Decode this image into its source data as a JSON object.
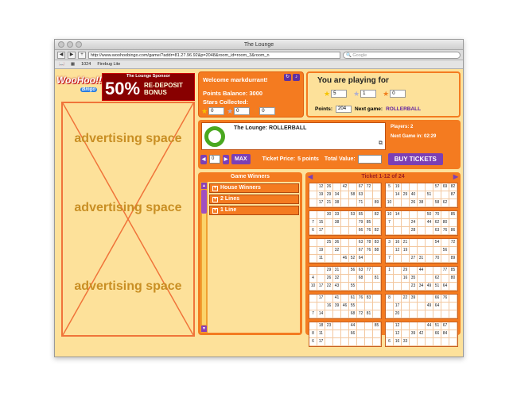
{
  "window": {
    "title": "The Lounge"
  },
  "browser": {
    "url": "http://www.woohoobingo.com/game/?addr=81.27.96.92&p=2048&room_id=room_3&room_n",
    "search_placeholder": "Google",
    "bookmarks": [
      "1024",
      "Firebug Lite"
    ]
  },
  "logo": {
    "text": "WooHoo!!",
    "badge": "Bingo"
  },
  "sponsor": {
    "label": "The Lounge Sponsor",
    "percent": "50%",
    "line1": "RE-DEPOSIT",
    "line2": "BONUS"
  },
  "ads": [
    "advertising space",
    "advertising space",
    "advertising space"
  ],
  "welcome": {
    "greeting": "Welcome markdurrant!",
    "points_balance": "Points Balance: 3000",
    "stars_label": "Stars Collected:",
    "stars": [
      "0",
      "0",
      "0"
    ]
  },
  "playing": {
    "title": "You are playing for",
    "stars": [
      "5",
      "1",
      "0"
    ],
    "points_label": "Points:",
    "points": "204",
    "next_game_label": "Next game:",
    "next_game": "ROLLERBALL"
  },
  "room": {
    "name": "The Lounge: ROLLERBALL",
    "players": "Players: 2",
    "next_game_in": "Next Game in:   02:29",
    "quantity": "0",
    "max_label": "MAX",
    "ticket_price_label": "Ticket Price:",
    "ticket_price": "5 points",
    "total_value_label": "Total Value:",
    "buy_label": "BUY TICKETS"
  },
  "winners": {
    "title": "Game Winners",
    "rows": [
      "House Winners",
      "2 Lines",
      "1 Line"
    ]
  },
  "tickets": {
    "title": "Ticket 1-12 of 24",
    "cards": [
      [
        [
          "",
          "12",
          "26",
          "",
          "42",
          "",
          "67",
          "72",
          ""
        ],
        [
          "",
          "19",
          "29",
          "34",
          "",
          "58",
          "63",
          "",
          ""
        ],
        [
          "",
          "17",
          "21",
          "38",
          "",
          "",
          "71",
          "",
          "89"
        ]
      ],
      [
        [
          "5",
          "19",
          "",
          "",
          "",
          "",
          "57",
          "69",
          "82"
        ],
        [
          "",
          "14",
          "29",
          "40",
          "",
          "51",
          "",
          "",
          "87"
        ],
        [
          "10",
          "",
          "",
          "26",
          "38",
          "",
          "58",
          "62",
          ""
        ]
      ],
      [
        [
          "",
          "",
          "30",
          "33",
          "",
          "53",
          "65",
          "",
          "82"
        ],
        [
          "7",
          "15",
          "",
          "38",
          "",
          "",
          "79",
          "85",
          ""
        ],
        [
          "6",
          "17",
          "",
          "",
          "",
          "",
          "66",
          "76",
          "82"
        ]
      ],
      [
        [
          "10",
          "14",
          "",
          "",
          "",
          "50",
          "70",
          "",
          "85"
        ],
        [
          "7",
          "",
          "",
          "24",
          "",
          "44",
          "62",
          "80",
          ""
        ],
        [
          "",
          "",
          "",
          "28",
          "",
          "",
          "63",
          "76",
          "86"
        ]
      ],
      [
        [
          "",
          "",
          "25",
          "36",
          "",
          "",
          "63",
          "78",
          "83"
        ],
        [
          "",
          "19",
          "",
          "32",
          "",
          "",
          "67",
          "76",
          "88"
        ],
        [
          "",
          "11",
          "",
          "",
          "46",
          "52",
          "64",
          "",
          ""
        ]
      ],
      [
        [
          "3",
          "16",
          "21",
          "",
          "",
          "",
          "54",
          "",
          "72"
        ],
        [
          "",
          "12",
          "19",
          "",
          "",
          "",
          "",
          "56",
          ""
        ],
        [
          "7",
          "",
          "",
          "27",
          "31",
          "",
          "70",
          "",
          "89"
        ]
      ],
      [
        [
          "",
          "",
          "29",
          "31",
          "",
          "56",
          "63",
          "77",
          ""
        ],
        [
          "4",
          "",
          "26",
          "32",
          "",
          "",
          "68",
          "",
          "81"
        ],
        [
          "10",
          "17",
          "22",
          "43",
          "",
          "55",
          "",
          "",
          ""
        ]
      ],
      [
        [
          "1",
          "",
          "29",
          "",
          "44",
          "",
          "",
          "77",
          "85"
        ],
        [
          "",
          "",
          "16",
          "35",
          "",
          "",
          "62",
          "",
          "80"
        ],
        [
          "",
          "",
          "",
          "23",
          "34",
          "49",
          "51",
          "64",
          ""
        ]
      ],
      [
        [
          "",
          "17",
          "",
          "41",
          "",
          "61",
          "76",
          "83",
          ""
        ],
        [
          "",
          "",
          "16",
          "39",
          "46",
          "55",
          "",
          "",
          ""
        ],
        [
          "7",
          "14",
          "",
          "",
          "",
          "68",
          "72",
          "81",
          ""
        ]
      ],
      [
        [
          "8",
          "",
          "22",
          "39",
          "",
          "",
          "66",
          "76",
          ""
        ],
        [
          "",
          "17",
          "",
          "",
          "",
          "49",
          "64",
          "",
          ""
        ],
        [
          "",
          "20",
          "",
          "",
          "",
          "",
          "",
          "",
          ""
        ]
      ],
      [
        [
          "",
          "18",
          "23",
          "",
          "",
          "44",
          "",
          "",
          "85"
        ],
        [
          "8",
          "11",
          "",
          "",
          "",
          "66",
          "",
          "",
          ""
        ],
        [
          "6",
          "17",
          "",
          "",
          "",
          "",
          "",
          "",
          ""
        ]
      ],
      [
        [
          "",
          "12",
          "",
          "",
          "",
          "44",
          "51",
          "67",
          ""
        ],
        [
          "",
          "12",
          "",
          "39",
          "42",
          "",
          "66",
          "84",
          ""
        ],
        [
          "6",
          "16",
          "33",
          "",
          "",
          "",
          "",
          "",
          ""
        ]
      ]
    ]
  }
}
